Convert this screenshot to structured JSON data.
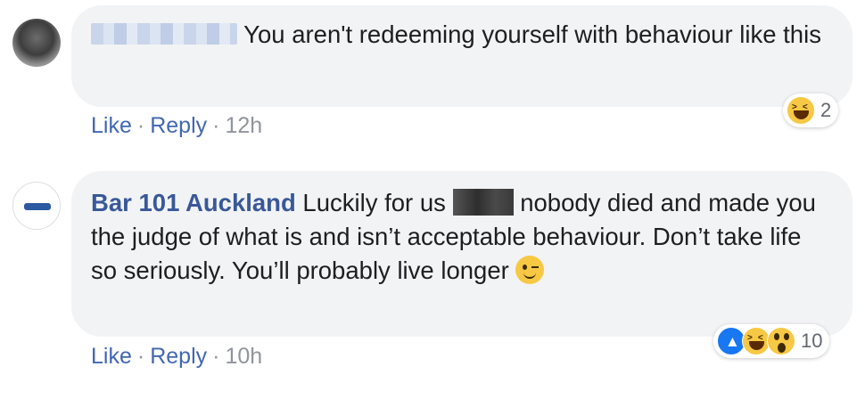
{
  "comments": [
    {
      "author": "",
      "text": "You aren't redeeming yourself with behaviour like this",
      "actions": {
        "like": "Like",
        "reply": "Reply",
        "separator": "·",
        "time": "12h"
      },
      "reactions": {
        "icons": [
          "haha-icon"
        ],
        "count": "2"
      }
    },
    {
      "author": "Bar 101 Auckland",
      "text_before_redaction": "Luckily for us",
      "text_after_redaction": "nobody died and made you the judge of what is and isn’t acceptable behaviour. Don’t take life so seriously. You’ll probably live longer",
      "actions": {
        "like": "Like",
        "reply": "Reply",
        "separator": "·",
        "time": "10h"
      },
      "reactions": {
        "icons": [
          "like-icon",
          "haha-icon",
          "wow-icon"
        ],
        "count": "10"
      }
    }
  ],
  "colors": {
    "bubble": "#f2f3f5",
    "author": "#385898",
    "link": "#4267b2",
    "meta": "#90949c"
  }
}
